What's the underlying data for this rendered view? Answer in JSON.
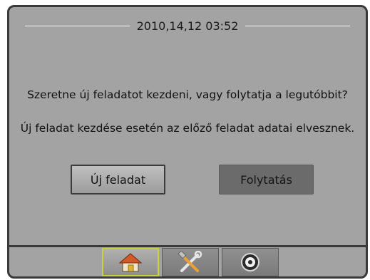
{
  "header": {
    "datetime": "2010,14,12 03:52"
  },
  "dialog": {
    "question": "Szeretne új feladatot kezdeni, vagy folytatja a legutóbbit?",
    "warning": "Új feladat kezdése esetén az előző feladat adatai elvesznek.",
    "new_task_label": "Új feladat",
    "continue_label": "Folytatás"
  },
  "tabs": [
    {
      "icon": "home-icon",
      "active": true
    },
    {
      "icon": "tools-icon",
      "active": false
    },
    {
      "icon": "gauge-icon",
      "active": false
    }
  ],
  "colors": {
    "background": "#a3a3a3",
    "active_tab_border": "#c8d23a",
    "continue_button": "#6b6b6b"
  }
}
